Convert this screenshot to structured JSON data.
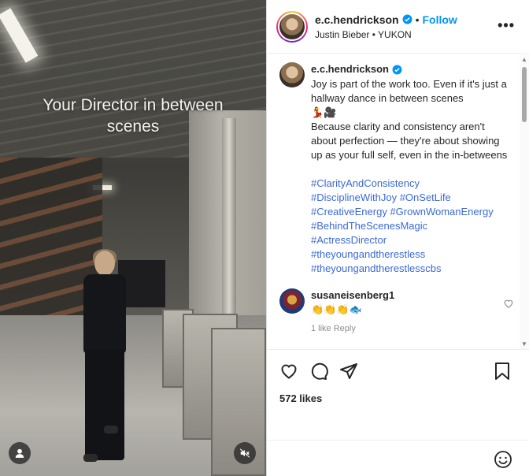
{
  "media": {
    "overlay_text": "Your Director in between scenes",
    "profile_icon": "person-icon",
    "mute_icon": "muted-speaker-icon"
  },
  "header": {
    "username": "e.c.hendrickson",
    "separator": "•",
    "follow_label": "Follow",
    "audio_info": "Justin Bieber • YUKON",
    "more_label": "•••"
  },
  "caption": {
    "username": "e.c.hendrickson",
    "line1": "Joy is part of the work too. Even if it's just a hallway dance in between scenes",
    "emoji": "💃🎥",
    "line2": "Because clarity and consistency aren't about perfection — they're about showing up as your full self, even in the in-betweens",
    "hashtags": [
      "#ClarityAndConsistency",
      "#DisciplineWithJoy #OnSetLife",
      "#CreativeEnergy #GrownWomanEnergy",
      "#BehindTheScenesMagic",
      "#ActressDirector",
      "#theyoungandtherestless",
      "#theyoungandtherestlesscbs"
    ]
  },
  "comments": [
    {
      "username": "susaneisenberg1",
      "text": "👏👏👏🐟",
      "meta": "1 like   Reply"
    }
  ],
  "actions": {
    "likes": "572 likes"
  },
  "colors": {
    "link": "#3a6ad6",
    "follow": "#0095f6",
    "verified": "#0095f6"
  }
}
